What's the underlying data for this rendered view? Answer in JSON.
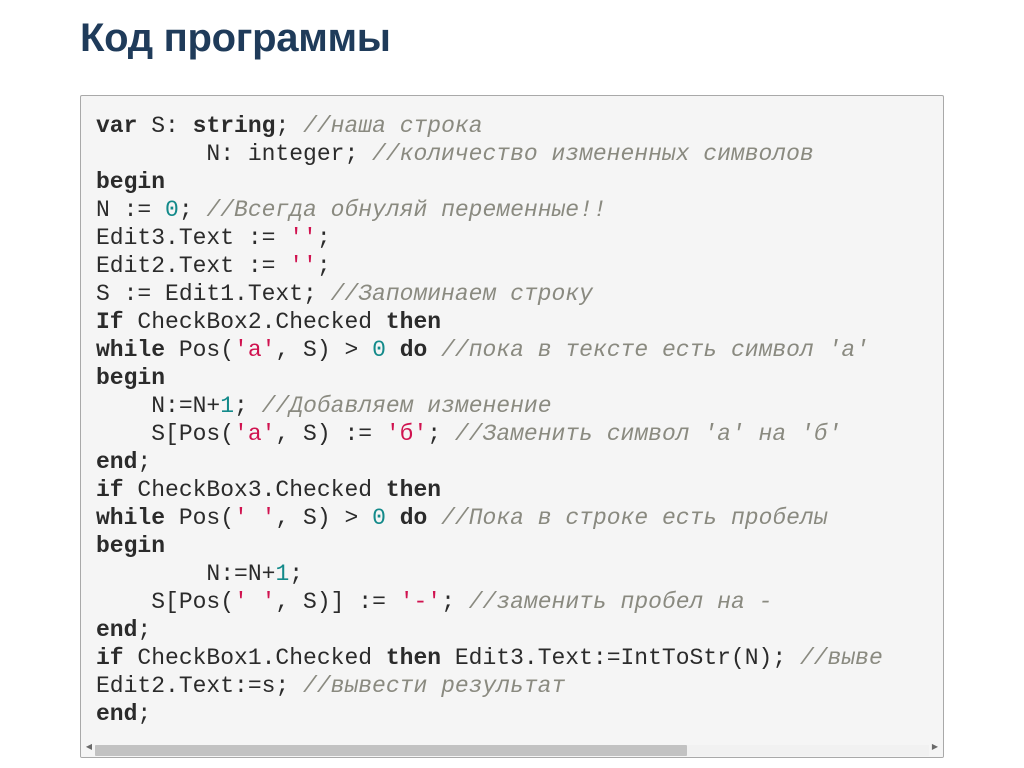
{
  "slide": {
    "title": "Код программы"
  },
  "colors": {
    "title": "#1f3b5a",
    "keyword": "#2b2b2b",
    "comment": "#8a8a80",
    "number": "#138a8a",
    "string": "#d0124f",
    "code_background": "#f5f5f5"
  },
  "scrollbar": {
    "left_arrow_icon": "arrow-left-icon",
    "right_arrow_icon": "arrow-right-icon",
    "position": 0,
    "visible_fraction": 0.71
  },
  "code": {
    "language": "pascal",
    "lines": [
      [
        {
          "t": "kw",
          "v": "var"
        },
        {
          "t": "p",
          "v": " S: "
        },
        {
          "t": "kw",
          "v": "string"
        },
        {
          "t": "p",
          "v": "; "
        },
        {
          "t": "cm",
          "v": "//наша строка"
        }
      ],
      [
        {
          "t": "p",
          "v": "        N: integer; "
        },
        {
          "t": "cm",
          "v": "//количество измененных символов"
        }
      ],
      [
        {
          "t": "kw",
          "v": "begin"
        }
      ],
      [
        {
          "t": "p",
          "v": "N := "
        },
        {
          "t": "num",
          "v": "0"
        },
        {
          "t": "p",
          "v": "; "
        },
        {
          "t": "cm",
          "v": "//Всегда обнуляй переменные!!"
        }
      ],
      [
        {
          "t": "p",
          "v": "Edit3.Text := "
        },
        {
          "t": "str",
          "v": "''"
        },
        {
          "t": "p",
          "v": ";"
        }
      ],
      [
        {
          "t": "p",
          "v": "Edit2.Text := "
        },
        {
          "t": "str",
          "v": "''"
        },
        {
          "t": "p",
          "v": ";"
        }
      ],
      [
        {
          "t": "p",
          "v": "S := Edit1.Text; "
        },
        {
          "t": "cm",
          "v": "//Запоминаем строку"
        }
      ],
      [
        {
          "t": "kw",
          "v": "If"
        },
        {
          "t": "p",
          "v": " CheckBox2.Checked "
        },
        {
          "t": "kw",
          "v": "then"
        }
      ],
      [
        {
          "t": "kw",
          "v": "while"
        },
        {
          "t": "p",
          "v": " Pos("
        },
        {
          "t": "str",
          "v": "'а'"
        },
        {
          "t": "p",
          "v": ", S) > "
        },
        {
          "t": "num",
          "v": "0"
        },
        {
          "t": "p",
          "v": " "
        },
        {
          "t": "kw",
          "v": "do"
        },
        {
          "t": "p",
          "v": " "
        },
        {
          "t": "cm",
          "v": "//пока в тексте есть символ 'а'"
        }
      ],
      [
        {
          "t": "kw",
          "v": "begin"
        }
      ],
      [
        {
          "t": "p",
          "v": "    N:=N+"
        },
        {
          "t": "num",
          "v": "1"
        },
        {
          "t": "p",
          "v": "; "
        },
        {
          "t": "cm",
          "v": "//Добавляем изменение"
        }
      ],
      [
        {
          "t": "p",
          "v": "    S[Pos("
        },
        {
          "t": "str",
          "v": "'а'"
        },
        {
          "t": "p",
          "v": ", S) := "
        },
        {
          "t": "str",
          "v": "'б'"
        },
        {
          "t": "p",
          "v": "; "
        },
        {
          "t": "cm",
          "v": "//Заменить символ 'а' на 'б'"
        }
      ],
      [
        {
          "t": "kw",
          "v": "end"
        },
        {
          "t": "p",
          "v": ";"
        }
      ],
      [
        {
          "t": "kw",
          "v": "if"
        },
        {
          "t": "p",
          "v": " CheckBox3.Checked "
        },
        {
          "t": "kw",
          "v": "then"
        }
      ],
      [
        {
          "t": "kw",
          "v": "while"
        },
        {
          "t": "p",
          "v": " Pos("
        },
        {
          "t": "str",
          "v": "' '"
        },
        {
          "t": "p",
          "v": ", S) > "
        },
        {
          "t": "num",
          "v": "0"
        },
        {
          "t": "p",
          "v": " "
        },
        {
          "t": "kw",
          "v": "do"
        },
        {
          "t": "p",
          "v": " "
        },
        {
          "t": "cm",
          "v": "//Пока в строке есть пробелы"
        }
      ],
      [
        {
          "t": "kw",
          "v": "begin"
        }
      ],
      [
        {
          "t": "p",
          "v": "        N:=N+"
        },
        {
          "t": "num",
          "v": "1"
        },
        {
          "t": "p",
          "v": ";"
        }
      ],
      [
        {
          "t": "p",
          "v": "    S[Pos("
        },
        {
          "t": "str",
          "v": "' '"
        },
        {
          "t": "p",
          "v": ", S)] := "
        },
        {
          "t": "str",
          "v": "'-'"
        },
        {
          "t": "p",
          "v": "; "
        },
        {
          "t": "cm",
          "v": "//заменить пробел на -"
        }
      ],
      [
        {
          "t": "kw",
          "v": "end"
        },
        {
          "t": "p",
          "v": ";"
        }
      ],
      [
        {
          "t": "kw",
          "v": "if"
        },
        {
          "t": "p",
          "v": " CheckBox1.Checked "
        },
        {
          "t": "kw",
          "v": "then"
        },
        {
          "t": "p",
          "v": " Edit3.Text:=IntToStr(N); "
        },
        {
          "t": "cm",
          "v": "//выве"
        }
      ],
      [
        {
          "t": "p",
          "v": "Edit2.Text:=s; "
        },
        {
          "t": "cm",
          "v": "//вывести результат"
        }
      ],
      [
        {
          "t": "kw",
          "v": "end"
        },
        {
          "t": "p",
          "v": ";"
        }
      ]
    ]
  }
}
